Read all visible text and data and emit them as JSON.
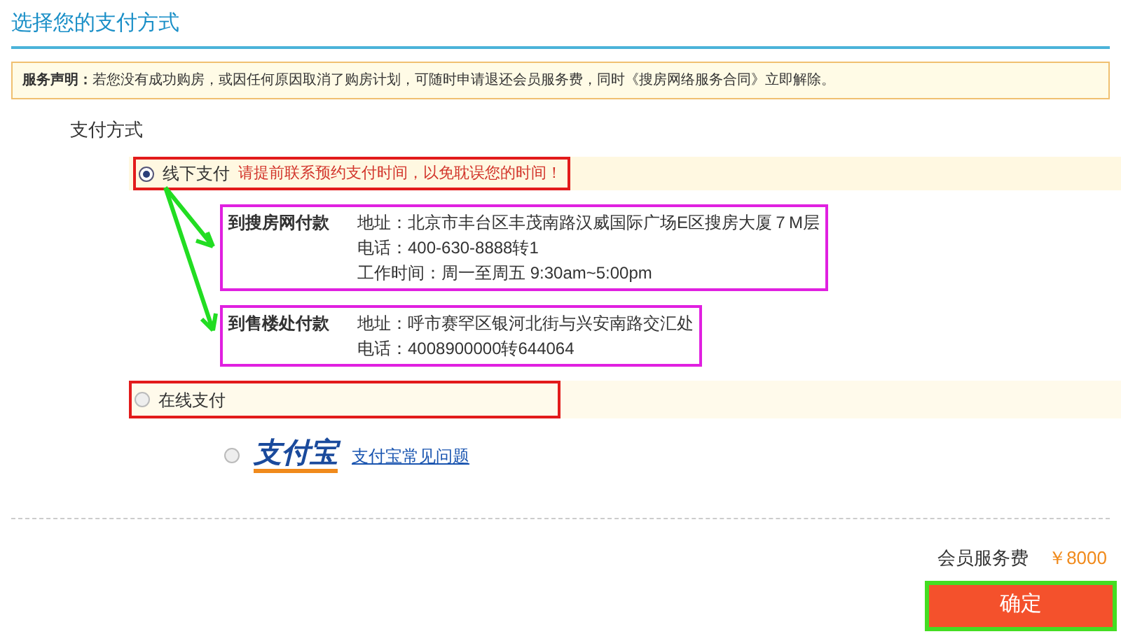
{
  "header": {
    "title": "选择您的支付方式"
  },
  "notice": {
    "label": "服务声明：",
    "text": "若您没有成功购房，或因任何原因取消了购房计划，可随时申请退还会员服务费，同时《搜房网络服务合同》立即解除。"
  },
  "section_title": "支付方式",
  "offline": {
    "label": "线下支付",
    "selected": true,
    "hint": "请提前联系预约支付时间，以免耽误您的时间！",
    "places": [
      {
        "name": "到搜房网付款",
        "lines": [
          "地址：北京市丰台区丰茂南路汉威国际广场E区搜房大厦７M层",
          "电话：400-630-8888转1",
          "工作时间：周一至周五 9:30am~5:00pm"
        ]
      },
      {
        "name": "到售楼处付款",
        "lines": [
          "地址：呼市赛罕区银河北街与兴安南路交汇处",
          "电话：4008900000转644064"
        ]
      }
    ]
  },
  "online": {
    "label": "在线支付",
    "selected": false,
    "options": [
      {
        "logo": "支付宝",
        "link": "支付宝常见问题",
        "selected": false
      }
    ]
  },
  "fee": {
    "label": "会员服务费",
    "amount": "￥8000"
  },
  "confirm": "确定"
}
